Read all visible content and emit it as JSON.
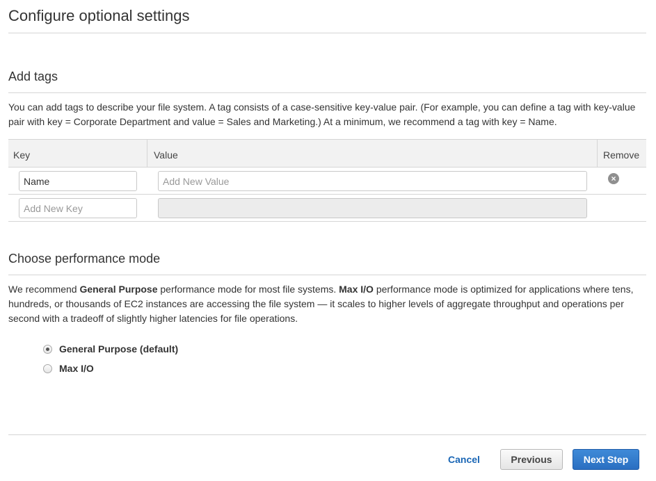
{
  "page": {
    "title": "Configure optional settings"
  },
  "tags": {
    "title": "Add tags",
    "description": "You can add tags to describe your file system. A tag consists of a case-sensitive key-value pair. (For example, you can define a tag with key-value pair with key = Corporate Department and value = Sales and Marketing.) At a minimum, we recommend a tag with key = Name.",
    "columns": {
      "key": "Key",
      "value": "Value",
      "remove": "Remove"
    },
    "rows": [
      {
        "key_value": "Name",
        "value_placeholder": "Add New Value",
        "remove_icon": "remove-circle-icon"
      },
      {
        "key_placeholder": "Add New Key",
        "value_disabled": true
      }
    ]
  },
  "performance": {
    "title": "Choose performance mode",
    "description_parts": {
      "p1": "We recommend ",
      "b1": "General Purpose",
      "p2": " performance mode for most file systems. ",
      "b2": "Max I/O",
      "p3": " performance mode is optimized for applications where tens, hundreds, or thousands of EC2 instances are accessing the file system — it scales to higher levels of aggregate throughput and operations per second with a tradeoff of slightly higher latencies for file operations."
    },
    "options": [
      {
        "label": "General Purpose (default)",
        "selected": true
      },
      {
        "label": "Max I/O",
        "selected": false
      }
    ]
  },
  "footer": {
    "cancel_label": "Cancel",
    "previous_label": "Previous",
    "next_label": "Next Step"
  },
  "colors": {
    "primary_button": "#2a6fc1",
    "link": "#1a66b5",
    "border": "#d5d5d5"
  }
}
